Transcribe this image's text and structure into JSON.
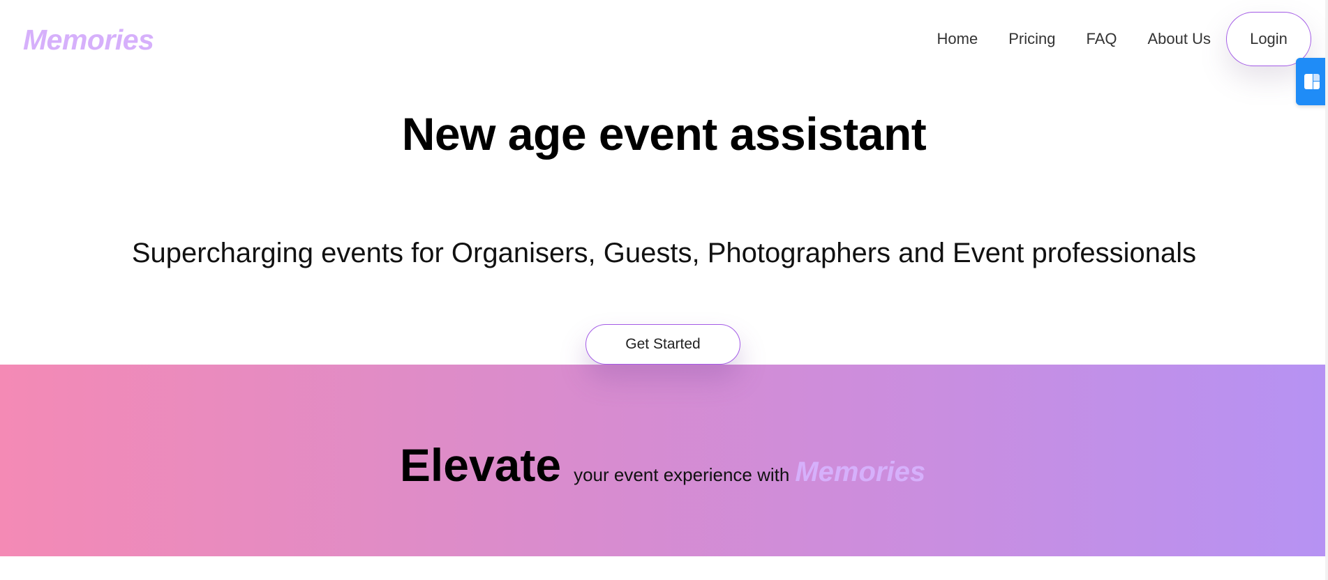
{
  "header": {
    "logo": "Memories",
    "nav": [
      {
        "label": "Home"
      },
      {
        "label": "Pricing"
      },
      {
        "label": "FAQ"
      },
      {
        "label": "About Us"
      }
    ],
    "login_label": "Login"
  },
  "hero": {
    "title": "New age event assistant",
    "subtitle": "Supercharging events for Organisers, Guests, Photographers and Event professionals",
    "cta_label": "Get Started"
  },
  "band": {
    "big": "Elevate",
    "small": "your event experience with",
    "brand": "Memories"
  },
  "widget": {
    "icon": "layout-panel-icon"
  },
  "colors": {
    "brand": "#d6b0fb",
    "button_border": "#a35be6",
    "gradient_start": "#f48ab5",
    "gradient_end": "#b692f3",
    "widget": "#1f8cf7"
  }
}
